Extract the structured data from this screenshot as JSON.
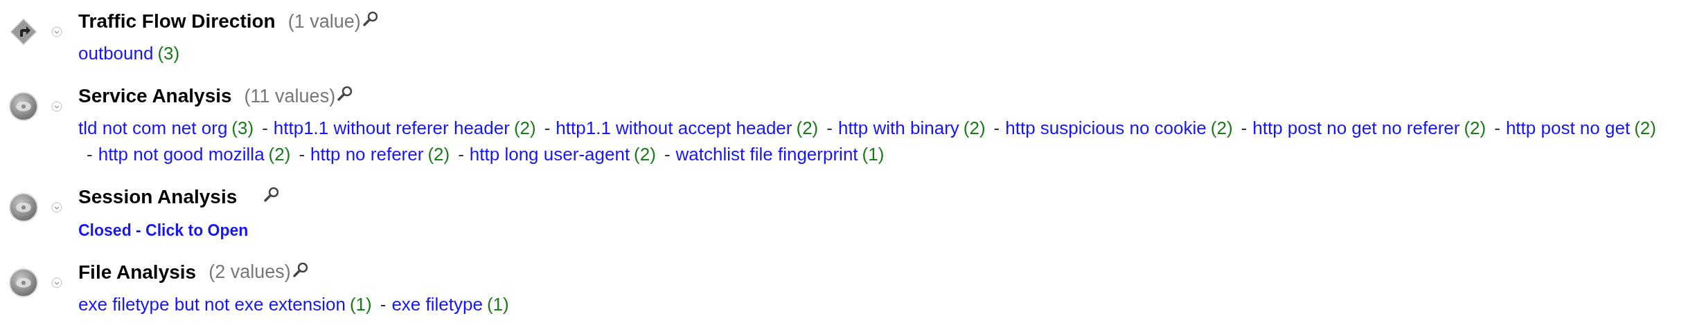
{
  "sections": [
    {
      "kind": "direction",
      "title": "Traffic Flow Direction",
      "count_text": "(1 value)",
      "values": [
        {
          "label": "outbound",
          "count": "(3)"
        }
      ]
    },
    {
      "kind": "analysis",
      "title": "Service Analysis",
      "count_text": "(11 values)",
      "values": [
        {
          "label": "tld not com net org",
          "count": "(3)"
        },
        {
          "separator": "-",
          "label": "http1.1 without referer header",
          "count": "(2)"
        },
        {
          "separator": "-",
          "label": "http1.1 without accept header",
          "count": "(2)"
        },
        {
          "separator": "-",
          "label": "http with binary",
          "count": "(2)"
        },
        {
          "separator": "-",
          "label": "http suspicious no cookie",
          "count": "(2)"
        },
        {
          "separator": "-",
          "label": "http post no get no referer",
          "count": "(2)"
        },
        {
          "separator": "-",
          "label": "http post no get",
          "count": "(2)"
        },
        {
          "separator": "-",
          "label": "http not good mozilla",
          "count": "(2)"
        },
        {
          "separator": "-",
          "label": "http no referer",
          "count": "(2)"
        },
        {
          "separator": "-",
          "label": "http long user-agent",
          "count": "(2)"
        },
        {
          "separator": "-",
          "label": "watchlist file fingerprint",
          "count": "(1)"
        }
      ]
    },
    {
      "kind": "analysis",
      "title": "Session Analysis",
      "closed_link": "Closed - Click to Open"
    },
    {
      "kind": "analysis",
      "title": "File Analysis",
      "count_text": "(2 values)",
      "values": [
        {
          "label": "exe filetype but not exe extension",
          "count": "(1)"
        },
        {
          "separator": "-",
          "label": "exe filetype",
          "count": "(1)"
        }
      ]
    }
  ]
}
